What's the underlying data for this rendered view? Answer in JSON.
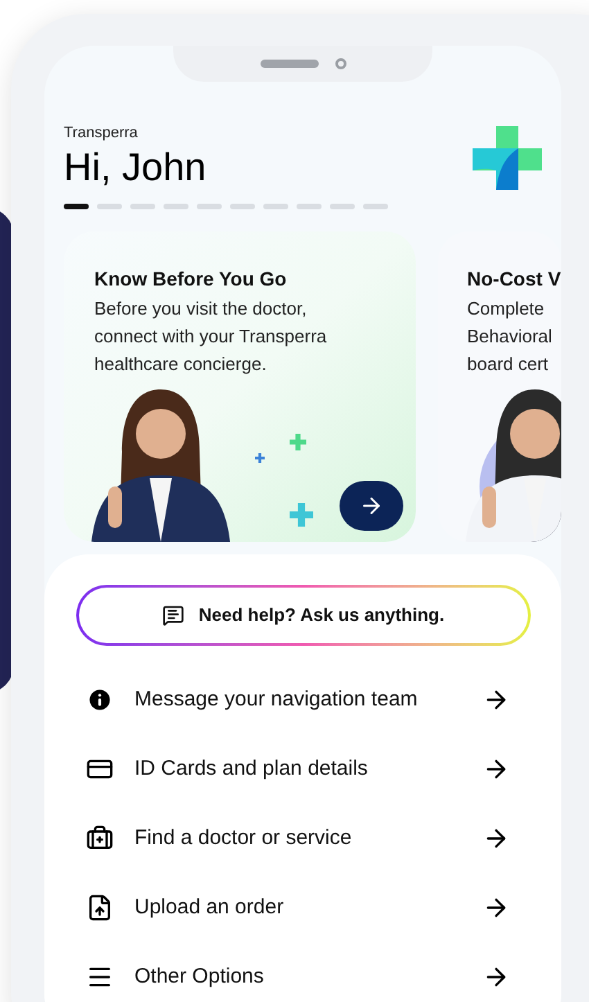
{
  "header": {
    "brand": "Transperra",
    "greeting": "Hi, John"
  },
  "carousel_dots": [
    {
      "selected": true
    },
    {
      "selected": false
    },
    {
      "selected": false
    },
    {
      "selected": false
    },
    {
      "selected": false
    },
    {
      "selected": false
    },
    {
      "selected": false
    },
    {
      "selected": false
    },
    {
      "selected": false
    },
    {
      "selected": false
    }
  ],
  "cards": [
    {
      "title": "Know Before You Go",
      "lines": [
        "Before you visit the doctor,",
        "connect with your Transperra",
        "healthcare concierge."
      ],
      "has_button": true
    },
    {
      "title": "No-Cost V",
      "lines": [
        "Complete",
        "Behavioral",
        "board cert"
      ],
      "has_button": false
    }
  ],
  "help_button": {
    "label": "Need help? Ask us anything."
  },
  "menu": [
    {
      "kind": "info",
      "label": "Message your navigation team"
    },
    {
      "kind": "card",
      "label": "ID Cards and plan details"
    },
    {
      "kind": "medkit",
      "label": "Find a doctor or service"
    },
    {
      "kind": "upload",
      "label": "Upload an order"
    },
    {
      "kind": "list",
      "label": "Other Options"
    }
  ]
}
